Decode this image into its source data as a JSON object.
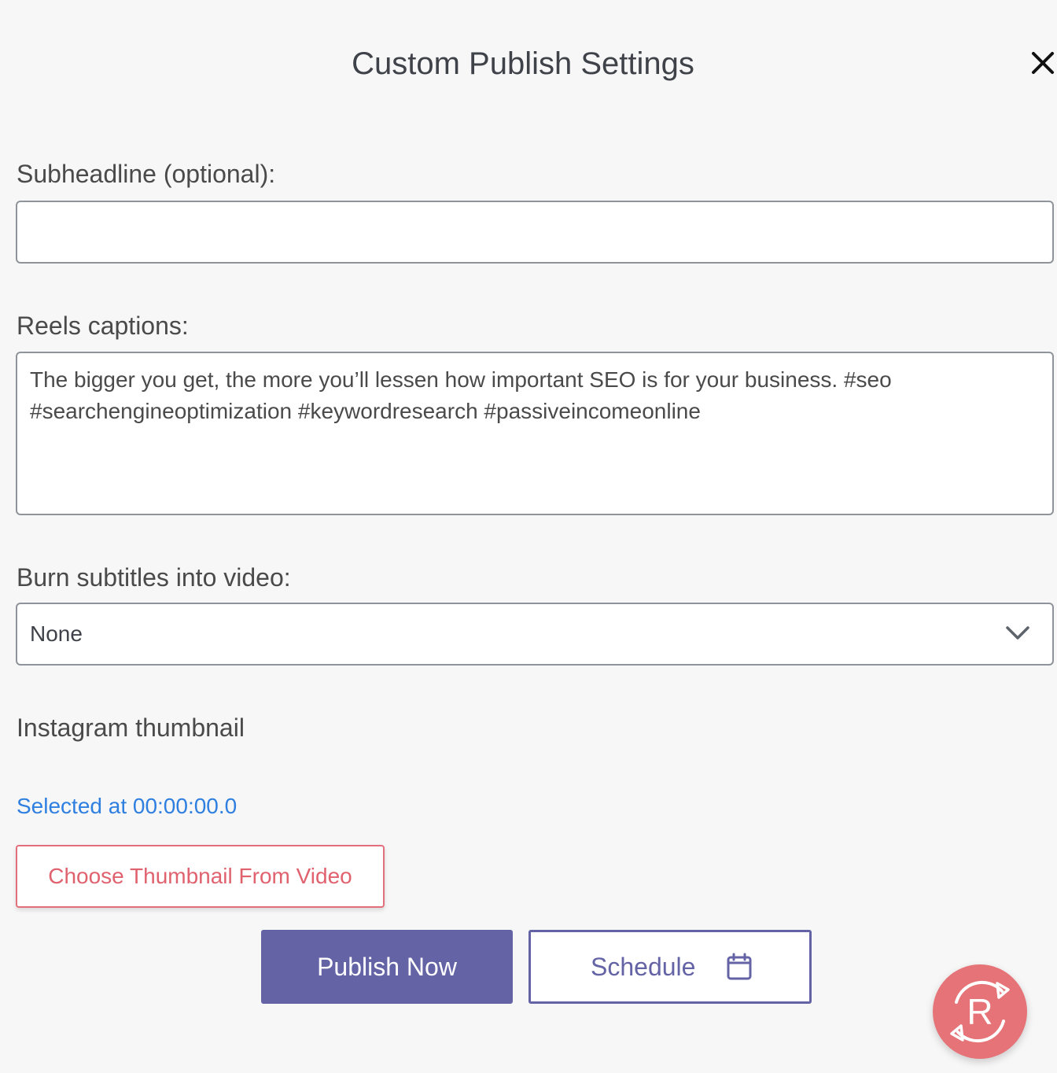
{
  "modal": {
    "title": "Custom Publish Settings"
  },
  "fields": {
    "subheadline": {
      "label": "Subheadline (optional):",
      "value": "",
      "placeholder": ""
    },
    "captions": {
      "label": "Reels captions:",
      "value": "The bigger you get, the more you’ll lessen how important SEO is for your business. #seo #searchengineoptimization #keywordresearch #passiveincomeonline"
    },
    "subtitles": {
      "label": "Burn subtitles into video:",
      "selected": "None"
    },
    "thumbnail": {
      "label": "Instagram thumbnail",
      "selected_text": "Selected at 00:00:00.0",
      "choose_button": "Choose Thumbnail From Video"
    }
  },
  "actions": {
    "publish_now": "Publish Now",
    "schedule": "Schedule"
  },
  "icons": {
    "close": "close-icon",
    "chevron": "chevron-down-icon",
    "calendar": "calendar-icon",
    "fab": "repurpose-logo-icon"
  },
  "colors": {
    "primary": "#6463a6",
    "accent": "#e46f7c",
    "link": "#2f7fe0",
    "fab": "#e57377",
    "background": "#f7f7f7"
  }
}
